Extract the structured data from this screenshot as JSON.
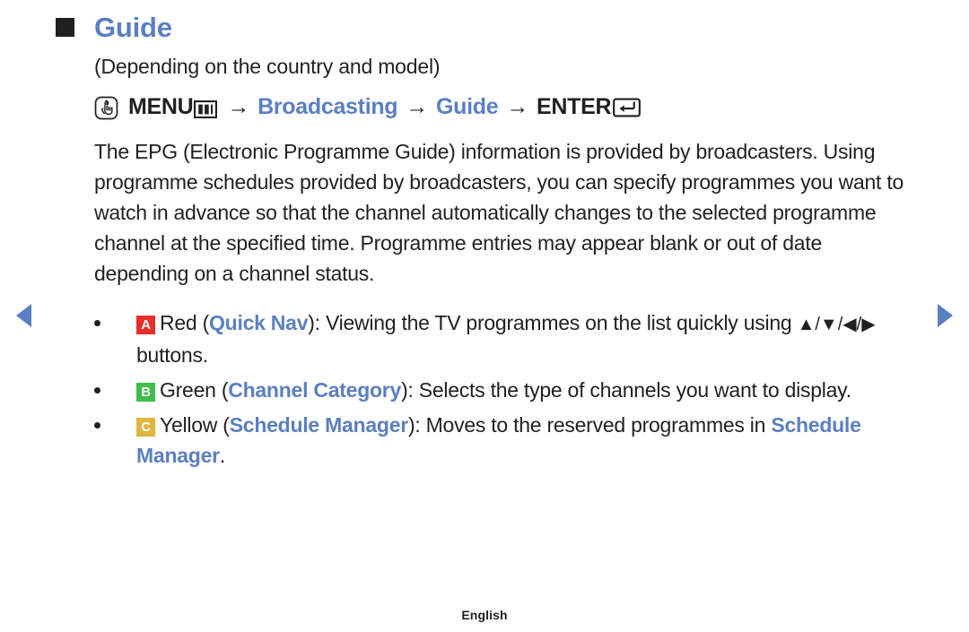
{
  "page": {
    "title": "Guide",
    "subtitle": "(Depending on the country and model)",
    "footer_language": "English",
    "accent_blue": "#5b7fc2",
    "text_color": "#231f20"
  },
  "nav": {
    "prev_label": "Previous page",
    "next_label": "Next page",
    "prev_icon": "triangle-left-icon",
    "next_icon": "triangle-right-icon"
  },
  "menu_path": {
    "touch_icon": "hand-touch-icon",
    "menu_label": "MENU",
    "menu_icon": "menu-grid-icon",
    "arrow": "→",
    "step_broadcasting": "Broadcasting",
    "step_guide": "Guide",
    "enter_label": "ENTER",
    "enter_icon": "enter-return-icon"
  },
  "description": {
    "paragraph": "The EPG (Electronic Programme Guide) information is provided by broadcasters. Using programme schedules provided by broadcasters, you can specify programmes you want to watch in advance so that the channel automatically changes to the selected programme channel at the specified time. Programme entries may appear blank or out of date depending on a channel status."
  },
  "bullets": [
    {
      "badge": "A",
      "badge_color": "#e8302a",
      "colour_name": "Red",
      "feature": "Quick Nav",
      "text_before": "Red (",
      "text_after_open": "): Viewing the TV programmes on the list quickly using ",
      "arrows": "▲/▼/◀/▶",
      "text_tail": " buttons."
    },
    {
      "badge": "B",
      "badge_color": "#3fbc4b",
      "colour_name": "Green",
      "feature": "Channel Category",
      "text_before": "Green (",
      "text_after_open": "): Selects the type of channels you want to display."
    },
    {
      "badge": "C",
      "badge_color": "#e0b63f",
      "colour_name": "Yellow",
      "feature": "Schedule Manager",
      "text_before": "Yellow (",
      "text_after_open": "): Moves to the reserved programmes in ",
      "link_tail": "Schedule Manager",
      "text_tail": "."
    }
  ]
}
